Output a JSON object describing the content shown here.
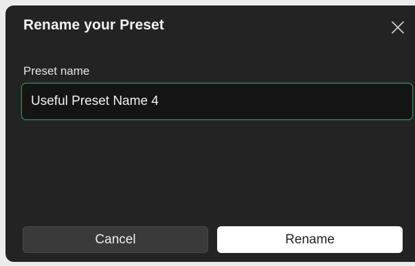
{
  "dialog": {
    "title": "Rename your Preset",
    "close_icon": "close-icon"
  },
  "form": {
    "label": "Preset name",
    "value": "Useful Preset Name 4"
  },
  "buttons": {
    "cancel": "Cancel",
    "rename": "Rename"
  },
  "colors": {
    "dialog_bg": "#232323",
    "input_bg": "#141414",
    "focus_border": "#3f8a55",
    "primary_button_bg": "#ffffff",
    "secondary_button_bg": "#3a3a3a"
  }
}
